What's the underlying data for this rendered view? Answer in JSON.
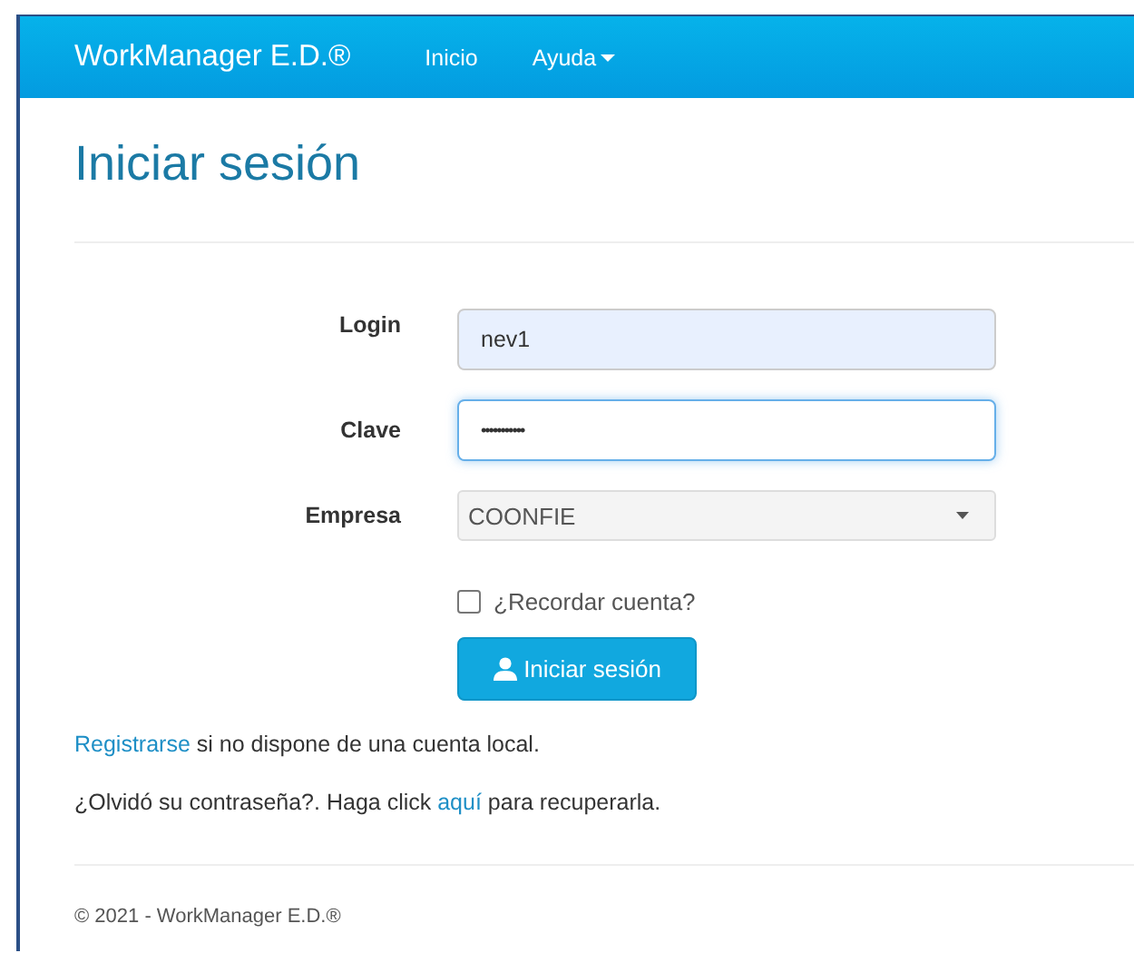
{
  "navbar": {
    "brand": "WorkManager E.D.®",
    "links": [
      {
        "label": "Inicio",
        "dropdown": false
      },
      {
        "label": "Ayuda",
        "dropdown": true
      }
    ]
  },
  "title": "Iniciar sesión",
  "form": {
    "fields": [
      {
        "kind": "text",
        "label": "Login",
        "value": "nev1",
        "autofilled": true,
        "focused": false
      },
      {
        "kind": "password",
        "label": "Clave",
        "value": "•••••••••••",
        "autofilled": false,
        "focused": true
      },
      {
        "kind": "select",
        "label": "Empresa",
        "value": "COONFIE"
      }
    ],
    "remember": {
      "label": "¿Recordar cuenta?",
      "checked": false
    },
    "submit": "Iniciar sesión"
  },
  "register": {
    "link": "Registrarse",
    "text": " si no dispone de una cuenta local."
  },
  "recover": {
    "before": "¿Olvidó su contraseña?. Haga click ",
    "link": "aquí",
    "after": " para recuperarla."
  },
  "footer": "© 2021 - WorkManager E.D.®"
}
